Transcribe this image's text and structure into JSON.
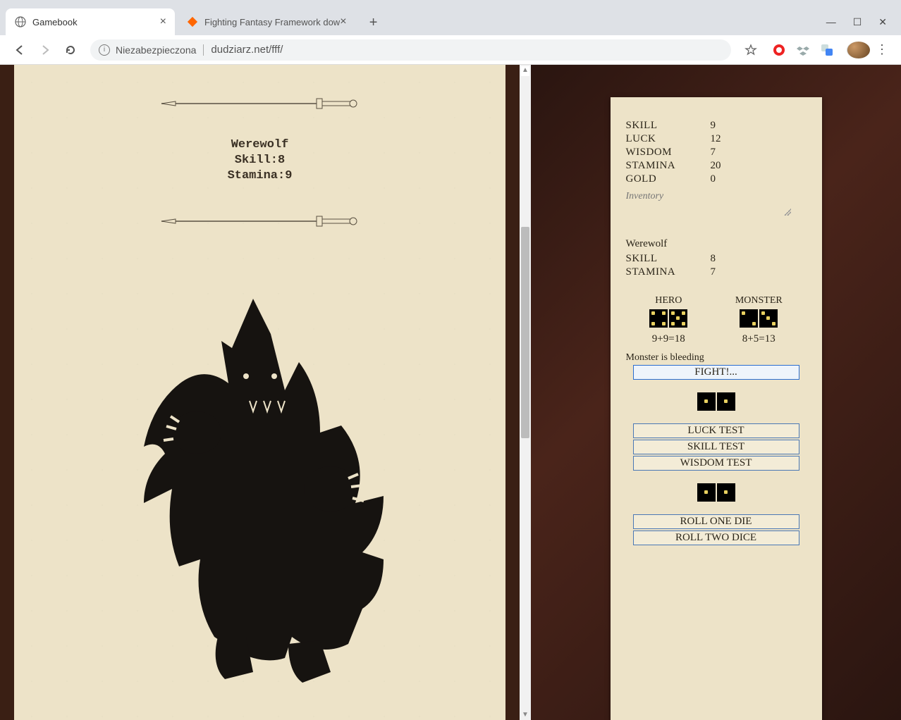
{
  "browser": {
    "tabs": [
      {
        "title": "Gamebook",
        "favicon": "globe",
        "active": true
      },
      {
        "title": "Fighting Fantasy Framework dow",
        "favicon": "sf",
        "active": false
      }
    ],
    "security_label": "Niezabezpieczona",
    "url": "dudziarz.net/fff/"
  },
  "page": {
    "enemy_name": "Werewolf",
    "enemy_skill_label": "Skill:8",
    "enemy_stamina_label": "Stamina:9"
  },
  "sheet": {
    "hero_stats": [
      {
        "label": "SKILL",
        "value": "9"
      },
      {
        "label": "LUCK",
        "value": "12"
      },
      {
        "label": "WISDOM",
        "value": "7"
      },
      {
        "label": "STAMINA",
        "value": "20"
      },
      {
        "label": "GOLD",
        "value": "0"
      }
    ],
    "inventory_placeholder": "Inventory",
    "monster": {
      "name": "Werewolf",
      "stats": [
        {
          "label": "SKILL",
          "value": "8"
        },
        {
          "label": "STAMINA",
          "value": "7"
        }
      ]
    },
    "combat": {
      "hero_label": "HERO",
      "monster_label": "MONSTER",
      "hero_dice": [
        4,
        5
      ],
      "monster_dice": [
        2,
        3
      ],
      "hero_calc": "9+9=18",
      "monster_calc": "8+5=13",
      "status": "Monster is bleeding",
      "fight_button": "FIGHT!..."
    },
    "test_dice": [
      1,
      1
    ],
    "test_buttons": {
      "luck": "LUCK TEST",
      "skill": "SKILL TEST",
      "wisdom": "WISDOM TEST"
    },
    "roll_dice": [
      1,
      1
    ],
    "roll_buttons": {
      "one": "ROLL ONE DIE",
      "two": "ROLL TWO DICE"
    }
  }
}
